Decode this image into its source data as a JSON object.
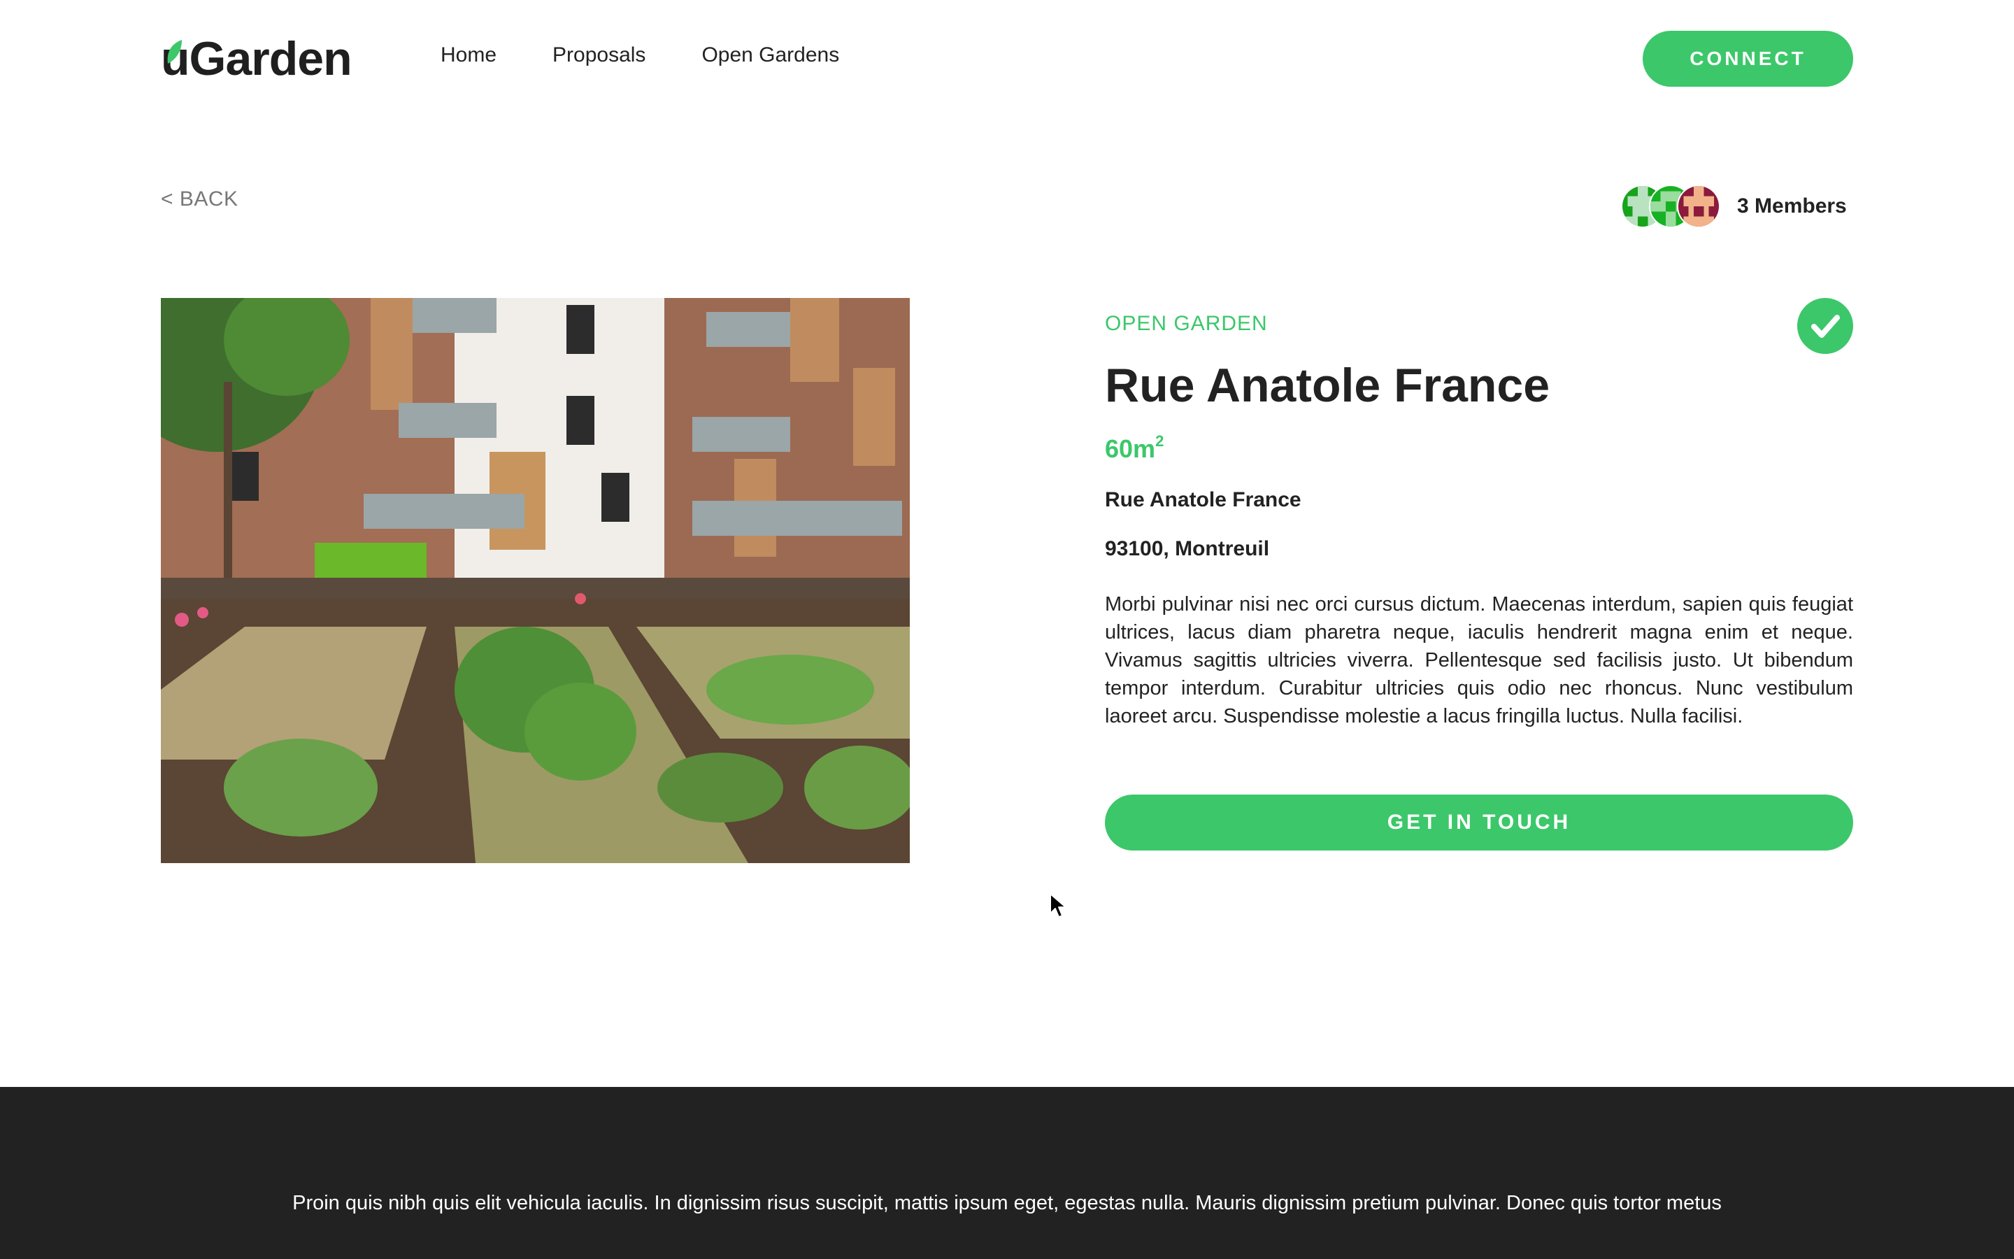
{
  "header": {
    "logo_first": "u",
    "logo_rest": "Garden",
    "nav": [
      "Home",
      "Proposals",
      "Open Gardens"
    ],
    "connect_label": "CONNECT"
  },
  "back_label": "< BACK",
  "members": {
    "count_label": "3 Members",
    "avatars": [
      "identicon-green-light",
      "identicon-green",
      "identicon-maroon"
    ]
  },
  "garden": {
    "status": "OPEN GARDEN",
    "title": "Rue Anatole France",
    "area": "60m",
    "area_unit_sup": "2",
    "street": "Rue Anatole France",
    "city": "93100, Montreuil",
    "description": "Morbi pulvinar nisi nec orci cursus dictum. Maecenas interdum, sapien quis feugiat ultrices, lacus diam pharetra neque, iaculis hendrerit magna enim et neque. Vivamus sagittis ultricies viverra. Pellentesque sed facilisis justo. Ut bibendum tempor interdum. Curabitur ultricies quis odio nec rhoncus. Nunc vestibulum laoreet arcu. Suspendisse molestie a lacus fringilla luctus. Nulla facilisi.",
    "cta_label": "GET IN TOUCH",
    "verified_icon": "checkmark-icon"
  },
  "footer": {
    "text": "Proin quis nibh quis elit vehicula iaculis. In dignissim risus suscipit, mattis ipsum eget, egestas nulla. Mauris dignissim pretium pulvinar. Donec quis tortor metus"
  },
  "colors": {
    "accent": "#3cc76a",
    "text": "#222222",
    "footer_bg": "#222222",
    "muted": "#777777"
  }
}
